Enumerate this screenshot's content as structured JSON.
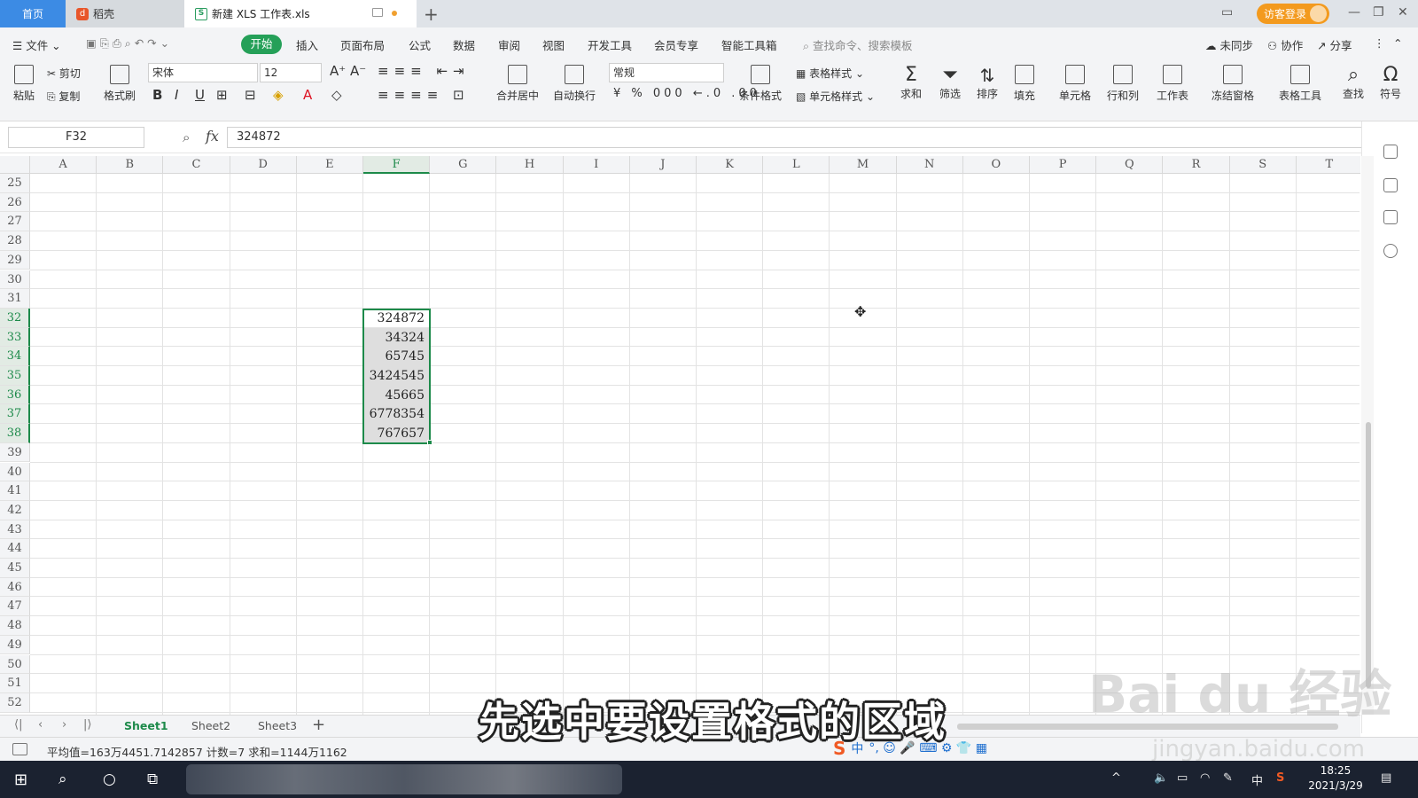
{
  "tabs": {
    "home": "首页",
    "docer": "稻壳",
    "file": "新建 XLS 工作表.xls",
    "login": "访客登录"
  },
  "menu": {
    "file": "文件",
    "items": [
      "开始",
      "插入",
      "页面布局",
      "公式",
      "数据",
      "审阅",
      "视图",
      "开发工具",
      "会员专享",
      "智能工具箱"
    ],
    "search_placeholder": "查找命令、搜索模板",
    "sync": "未同步",
    "collab": "协作",
    "share": "分享"
  },
  "ribbon": {
    "paste": "粘贴",
    "cut": "剪切",
    "copy": "复制",
    "format_painter": "格式刷",
    "font_name": "宋体",
    "font_size": "12",
    "merge_center": "合并居中",
    "wrap_text": "自动换行",
    "number_format": "常规",
    "table_style": "表格样式",
    "cond_format": "条件格式",
    "cell_style": "单元格样式",
    "sum": "求和",
    "filter": "筛选",
    "sort": "排序",
    "fill": "填充",
    "cell": "单元格",
    "row_col": "行和列",
    "worksheet": "工作表",
    "freeze": "冻结窗格",
    "table_tools": "表格工具",
    "find": "查找",
    "symbol": "符号"
  },
  "formula_bar": {
    "name_box": "F32",
    "fx": "fx",
    "value": "324872"
  },
  "columns": [
    "A",
    "B",
    "C",
    "D",
    "E",
    "F",
    "G",
    "H",
    "I",
    "J",
    "K",
    "L",
    "M",
    "N",
    "O",
    "P",
    "Q",
    "R",
    "S",
    "T"
  ],
  "active_column": "F",
  "rows": [
    "25",
    "26",
    "27",
    "28",
    "29",
    "30",
    "31",
    "32",
    "33",
    "34",
    "35",
    "36",
    "37",
    "38",
    "39",
    "40",
    "41",
    "42",
    "43",
    "44",
    "45",
    "46",
    "47",
    "48",
    "49",
    "50",
    "51",
    "52"
  ],
  "selected_rows": [
    "32",
    "33",
    "34",
    "35",
    "36",
    "37",
    "38"
  ],
  "cells_F": [
    "324872",
    "34324",
    "65745",
    "3424545",
    "45665",
    "6778354",
    "767657"
  ],
  "sheets": [
    "Sheet1",
    "Sheet2",
    "Sheet3"
  ],
  "active_sheet": "Sheet1",
  "status": "平均值=163万4451.7142857  计数=7  求和=1144万1162",
  "subtitle": "先选中要设置格式的区域",
  "watermark": "Bai du 经验",
  "watermark_url": "jingyan.baidu.com",
  "ime": "中",
  "taskbar": {
    "time": "18:25",
    "date": "2021/3/29",
    "lang": "中"
  },
  "colors": {
    "accent_green": "#1d8a4a",
    "menu_active": "#25a058",
    "home_tab": "#3c8be4",
    "login": "#f39a1e"
  }
}
